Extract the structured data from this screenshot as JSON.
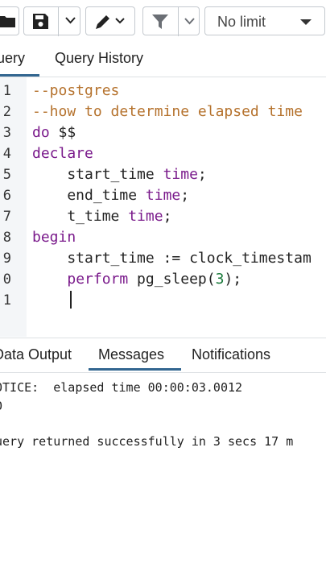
{
  "toolbar": {
    "limit_select": {
      "value": "No limit"
    }
  },
  "tabs_top": [
    {
      "label": "Query",
      "active": true
    },
    {
      "label": "Query History",
      "active": false
    }
  ],
  "editor": {
    "line_numbers": [
      "1",
      "2",
      "3",
      "4",
      "5",
      "6",
      "7",
      "8",
      "9",
      "0",
      "1"
    ],
    "lines": [
      [
        {
          "t": "--postgres",
          "c": "comment"
        }
      ],
      [
        {
          "t": "--how to determine elapsed time",
          "c": "comment"
        }
      ],
      [
        {
          "t": "do",
          "c": "kw"
        },
        {
          "t": " $$",
          "c": ""
        }
      ],
      [
        {
          "t": "declare",
          "c": "kw"
        }
      ],
      [
        {
          "t": "    start_time ",
          "c": ""
        },
        {
          "t": "time",
          "c": "kw"
        },
        {
          "t": ";",
          "c": ""
        }
      ],
      [
        {
          "t": "    end_time ",
          "c": ""
        },
        {
          "t": "time",
          "c": "kw"
        },
        {
          "t": ";",
          "c": ""
        }
      ],
      [
        {
          "t": "    t_time ",
          "c": ""
        },
        {
          "t": "time",
          "c": "kw"
        },
        {
          "t": ";",
          "c": ""
        }
      ],
      [
        {
          "t": "begin",
          "c": "kw"
        }
      ],
      [
        {
          "t": "    start_time := clock_timestam",
          "c": ""
        }
      ],
      [
        {
          "t": "    ",
          "c": ""
        },
        {
          "t": "perform",
          "c": "kw"
        },
        {
          "t": " pg_sleep(",
          "c": ""
        },
        {
          "t": "3",
          "c": "num"
        },
        {
          "t": ");",
          "c": ""
        }
      ],
      [
        {
          "t": "",
          "c": ""
        }
      ]
    ]
  },
  "tabs_bottom": [
    {
      "label": "Data Output",
      "active": false
    },
    {
      "label": "Messages",
      "active": true
    },
    {
      "label": "Notifications",
      "active": false
    }
  ],
  "messages": [
    "OTICE:  elapsed time 00:00:03.0012",
    "O",
    "",
    "uery returned successfully in 3 secs 17 m"
  ],
  "colors": {
    "comment": "#b5722d",
    "keyword": "#7a1a8b",
    "number": "#1a7a3b",
    "active_tab_underline": "#326690"
  }
}
